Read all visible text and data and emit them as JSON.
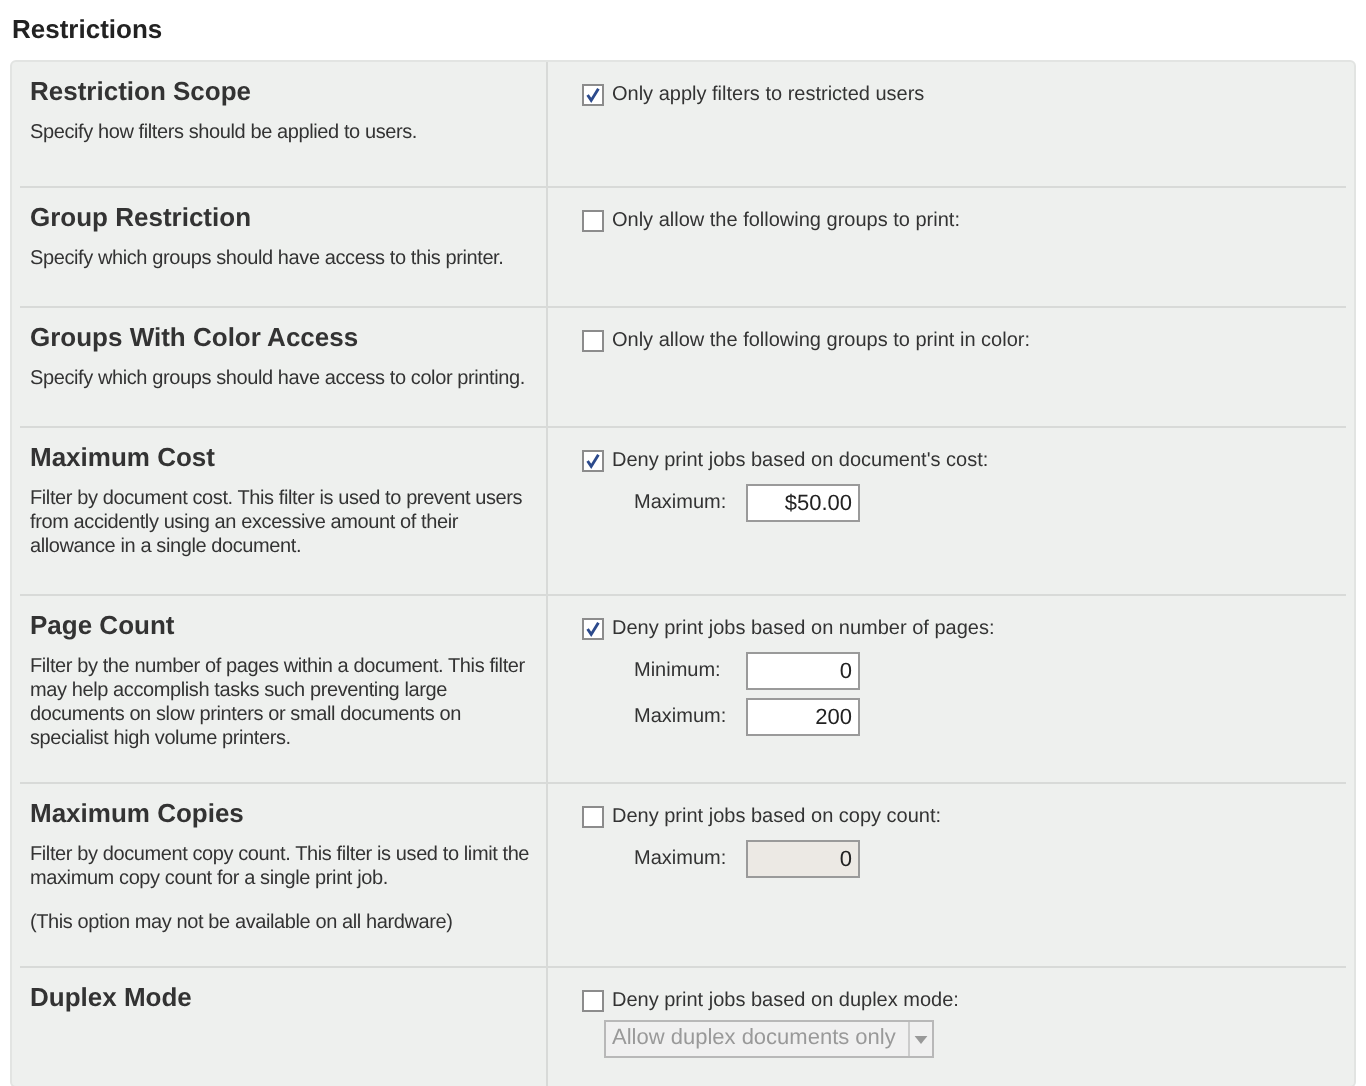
{
  "heading": "Restrictions",
  "rows": [
    {
      "title": "Restriction Scope",
      "description": [
        "Specify how filters should be applied to users."
      ],
      "option": {
        "label": "Only apply filters to restricted users",
        "checked": true
      }
    },
    {
      "title": "Group Restriction",
      "description": [
        "Specify which groups should have access to this printer."
      ],
      "option": {
        "label": "Only allow the following groups to print:",
        "checked": false
      }
    },
    {
      "title": "Groups With Color Access",
      "description": [
        "Specify which groups should have access to color printing."
      ],
      "option": {
        "label": "Only allow the following groups to print in color:",
        "checked": false
      }
    },
    {
      "title": "Maximum Cost",
      "description": [
        "Filter by document cost. This filter is used to prevent users from accidently using an excessive amount of their allowance in a single document."
      ],
      "option": {
        "label": "Deny print jobs based on document's cost:",
        "checked": true
      },
      "fields": [
        {
          "kind": "text",
          "label": "Maximum:",
          "value": "$50.00",
          "disabled": false
        }
      ]
    },
    {
      "title": "Page Count",
      "description": [
        "Filter by the number of pages within a document. This filter may help accomplish tasks such preventing large documents on slow printers or small documents on specialist high volume printers."
      ],
      "option": {
        "label": "Deny print jobs based on number of pages:",
        "checked": true
      },
      "fields": [
        {
          "kind": "text",
          "label": "Minimum:",
          "value": "0",
          "disabled": false
        },
        {
          "kind": "text",
          "label": "Maximum:",
          "value": "200",
          "disabled": false
        }
      ]
    },
    {
      "title": "Maximum Copies",
      "description": [
        "Filter by document copy count. This filter is used to limit the maximum copy count for a single print job.",
        "(This option may not be available on all hardware)"
      ],
      "option": {
        "label": "Deny print jobs based on copy count:",
        "checked": false
      },
      "fields": [
        {
          "kind": "text",
          "label": "Maximum:",
          "value": "0",
          "disabled": true
        }
      ]
    },
    {
      "title": "Duplex Mode",
      "option": {
        "label": "Deny print jobs based on duplex mode:",
        "checked": false
      },
      "fields": [
        {
          "kind": "select",
          "value": "Allow duplex documents only",
          "disabled": true
        }
      ]
    }
  ]
}
